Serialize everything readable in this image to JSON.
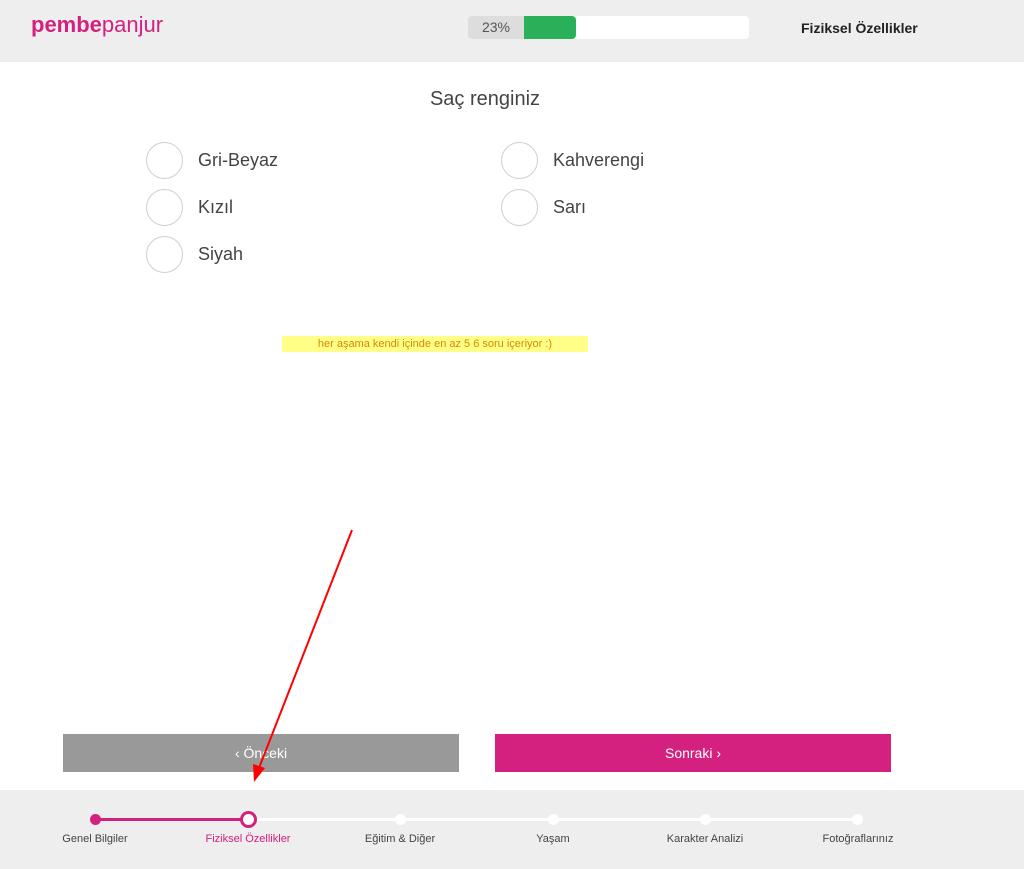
{
  "header": {
    "logo_bold": "pembe",
    "logo_light": "panjur",
    "progress_label": "23%",
    "progress_fraction": 0.23,
    "current_step": "Fiziksel Özellikler"
  },
  "question": {
    "title": "Saç renginiz",
    "options_left": [
      "Gri-Beyaz",
      "Kızıl",
      "Siyah"
    ],
    "options_right": [
      "Kahverengi",
      "Sarı"
    ]
  },
  "note": "her aşama kendi içinde en az 5 6 soru içeriyor :)",
  "nav": {
    "prev_label": "‹ Önceki",
    "next_label": "Sonraki ›"
  },
  "steps": [
    "Genel Bilgiler",
    "Fiziksel Özellikler",
    "Eğitim & Diğer",
    "Yaşam",
    "Karakter Analizi",
    "Fotoğraflarınız"
  ],
  "colors": {
    "brand": "#d4207e",
    "progress": "#2bb05a",
    "annotation": "#ff0000"
  }
}
